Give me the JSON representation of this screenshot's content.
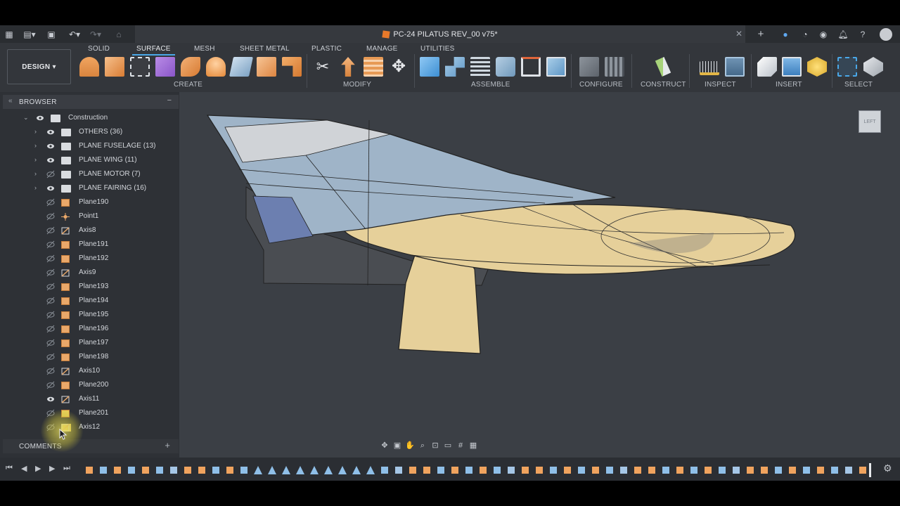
{
  "app": {
    "document_title": "PC-24 PILATUS REV_00 v75*",
    "workspace": "DESIGN"
  },
  "ribbon": {
    "tabs": [
      "SOLID",
      "SURFACE",
      "MESH",
      "SHEET METAL",
      "PLASTIC",
      "MANAGE",
      "UTILITIES"
    ],
    "active_tab": "SURFACE",
    "groups": [
      "CREATE",
      "MODIFY",
      "ASSEMBLE",
      "CONFIGURE",
      "CONSTRUCT",
      "INSPECT",
      "INSERT",
      "SELECT"
    ]
  },
  "browser": {
    "title": "BROWSER",
    "root": "Construction",
    "folders": [
      {
        "label": "OTHERS (36)",
        "visible": true
      },
      {
        "label": "PLANE FUSELAGE (13)",
        "visible": true
      },
      {
        "label": "PLANE WING (11)",
        "visible": true
      },
      {
        "label": "PLANE MOTOR (7)",
        "visible": false
      },
      {
        "label": "PLANE FAIRING (16)",
        "visible": true
      }
    ],
    "items": [
      {
        "label": "Plane190",
        "type": "plane",
        "visible": false
      },
      {
        "label": "Point1",
        "type": "point",
        "visible": false
      },
      {
        "label": "Axis8",
        "type": "axis",
        "visible": false
      },
      {
        "label": "Plane191",
        "type": "plane",
        "visible": false
      },
      {
        "label": "Plane192",
        "type": "plane",
        "visible": false
      },
      {
        "label": "Axis9",
        "type": "axis",
        "visible": false
      },
      {
        "label": "Plane193",
        "type": "plane",
        "visible": false
      },
      {
        "label": "Plane194",
        "type": "plane",
        "visible": false
      },
      {
        "label": "Plane195",
        "type": "plane",
        "visible": false
      },
      {
        "label": "Plane196",
        "type": "plane",
        "visible": false
      },
      {
        "label": "Plane197",
        "type": "plane",
        "visible": false
      },
      {
        "label": "Plane198",
        "type": "plane",
        "visible": false
      },
      {
        "label": "Axis10",
        "type": "axis",
        "visible": false
      },
      {
        "label": "Plane200",
        "type": "plane",
        "visible": false
      },
      {
        "label": "Axis11",
        "type": "axis",
        "visible": true
      },
      {
        "label": "Plane201",
        "type": "plane",
        "visible": false
      },
      {
        "label": "Axis12",
        "type": "axis",
        "visible": false
      }
    ]
  },
  "comments": {
    "title": "COMMENTS"
  },
  "viewcube": {
    "face": "LEFT"
  },
  "colors": {
    "accent": "#4aa8e8",
    "plane_icon": "#e9a86a",
    "model_tan": "#e6d09a",
    "model_blue": "#9fb4c8"
  }
}
